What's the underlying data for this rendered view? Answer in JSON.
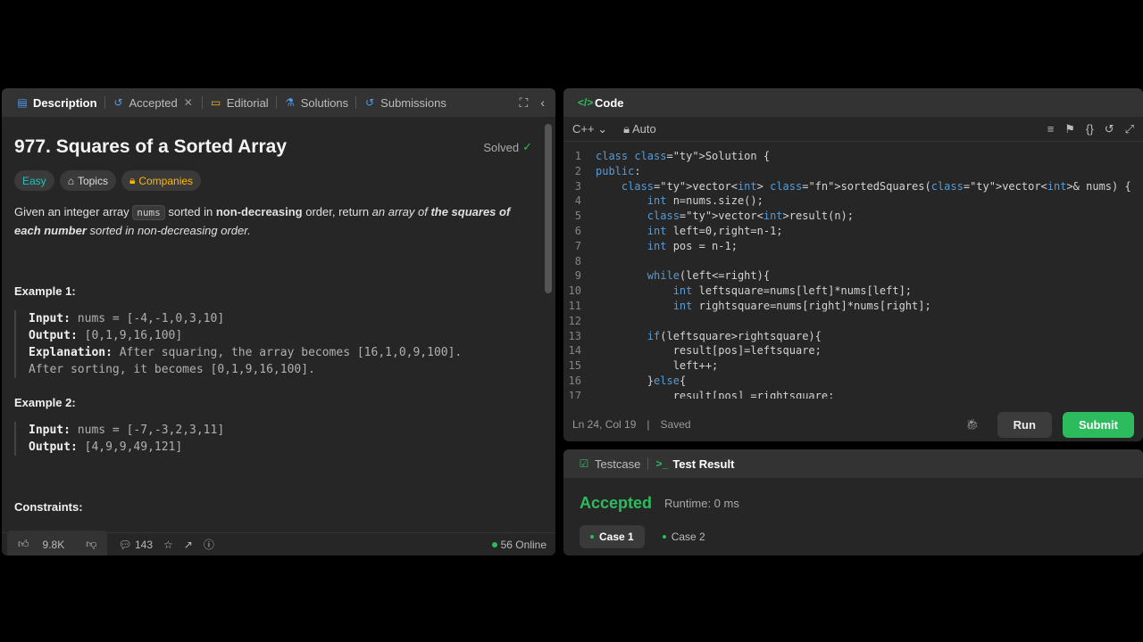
{
  "left_tabs": {
    "description": "Description",
    "accepted": "Accepted",
    "editorial": "Editorial",
    "solutions": "Solutions",
    "submissions": "Submissions"
  },
  "problem": {
    "title": "977. Squares of a Sorted Array",
    "solved_label": "Solved",
    "tags": {
      "difficulty": "Easy",
      "topics": "Topics",
      "companies": "Companies"
    },
    "statement": {
      "p1": "Given an integer array ",
      "code": "nums",
      "p2": " sorted in ",
      "bold1": "non-decreasing",
      "p3": " order, return ",
      "italic1": "an array of ",
      "bolditalic": "the squares of each number",
      "italic2": " sorted in non-decreasing order."
    },
    "example1": {
      "title": "Example 1:",
      "input_label": "Input:",
      "input_value": " nums = [-4,-1,0,3,10]",
      "output_label": "Output:",
      "output_value": " [0,1,9,16,100]",
      "explanation_label": "Explanation:",
      "explanation_value": " After squaring, the array becomes [16,1,0,9,100].",
      "explanation_line2": "After sorting, it becomes [0,1,9,16,100]."
    },
    "example2": {
      "title": "Example 2:",
      "input_label": "Input:",
      "input_value": " nums = [-7,-3,2,3,11]",
      "output_label": "Output:",
      "output_value": " [4,9,9,49,121]"
    },
    "constraints_title": "Constraints:"
  },
  "bottom_bar": {
    "likes": "9.8K",
    "comments": "143",
    "online": "56 Online"
  },
  "code_panel": {
    "title": "Code",
    "language": "C++",
    "mode": "Auto",
    "lines": [
      "class Solution {",
      "public:",
      "    vector<int> sortedSquares(vector<int>& nums) {",
      "        int n=nums.size();",
      "        vector<int>result(n);",
      "        int left=0,right=n-1;",
      "        int pos = n-1;",
      "",
      "        while(left<=right){",
      "            int leftsquare=nums[left]*nums[left];",
      "            int rightsquare=nums[right]*nums[right];",
      "",
      "        if(leftsquare>rightsquare){",
      "            result[pos]=leftsquare;",
      "            left++;",
      "        }else{",
      "            result[pos] =rightsquare;"
    ],
    "cursor": "Ln 24, Col 19",
    "saved": "Saved",
    "run_label": "Run",
    "submit_label": "Submit"
  },
  "result_panel": {
    "testcase_tab": "Testcase",
    "result_tab": "Test Result",
    "status": "Accepted",
    "runtime": "Runtime: 0 ms",
    "cases": [
      "Case 1",
      "Case 2"
    ]
  },
  "colors": {
    "accent_green": "#2cbb5d",
    "link_blue": "#4e9bf5",
    "easy_teal": "#26c0bd",
    "companies_orange": "#ffb800"
  }
}
